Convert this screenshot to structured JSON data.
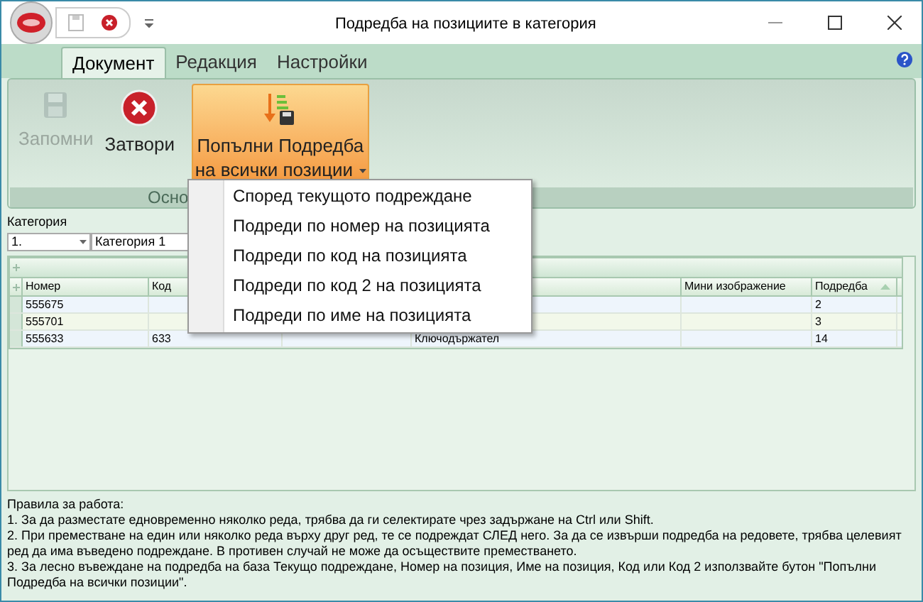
{
  "window": {
    "title": "Подредба на позициите в категория"
  },
  "ribbon_tabs": [
    {
      "label": "Документ",
      "selected": true
    },
    {
      "label": "Редакция",
      "selected": false
    },
    {
      "label": "Настройки",
      "selected": false
    }
  ],
  "ribbon_buttons": [
    {
      "kind": "save",
      "label": "Запомни",
      "disabled": true
    },
    {
      "kind": "close",
      "label": "Затвори",
      "disabled": false
    },
    {
      "kind": "fill",
      "label": "Попълни Подредба на всички позиции",
      "disabled": false,
      "expanded": true
    }
  ],
  "ribbon_group": {
    "label": "Осно"
  },
  "dropdown_menu": [
    "Според текущото подреждане",
    "Подреди по номер на позицията",
    "Подреди по код на позицията",
    "Подреди по код 2 на позицията",
    "Подреди по име на позицията"
  ],
  "category": {
    "label": "Категория",
    "number": "1.",
    "name": "Категория 1"
  },
  "table": {
    "columns": {
      "number": "Номер",
      "code": "Код",
      "thumbnail": "Мини изображение",
      "order": "Подредба"
    },
    "rows": [
      {
        "number": "555675",
        "order": "2"
      },
      {
        "number": "555701",
        "order": "3"
      },
      {
        "number": "555633",
        "code": "633",
        "column_4": "Ключодържател",
        "order": "14"
      }
    ]
  },
  "help": [
    "Правила за работа:",
    "1. За да разместате едновременно няколко реда, трябва да ги селектирате чрез задържане на Ctrl или Shift.",
    "2. При преместване на един или няколко реда върху друг ред, те се подреждат СЛЕД него. За да се извърши подредба на редовете, трябва целевият ред да има въведено подреждане. В противен случай не може да осъществите преместването.",
    "3. За лесно въвеждане на подредба на база Текущо подреждане, Номер на позиция, Име на позиция, Код или Код 2 използвайте бутон \"Попълни Подредба на всички позиции\"."
  ]
}
